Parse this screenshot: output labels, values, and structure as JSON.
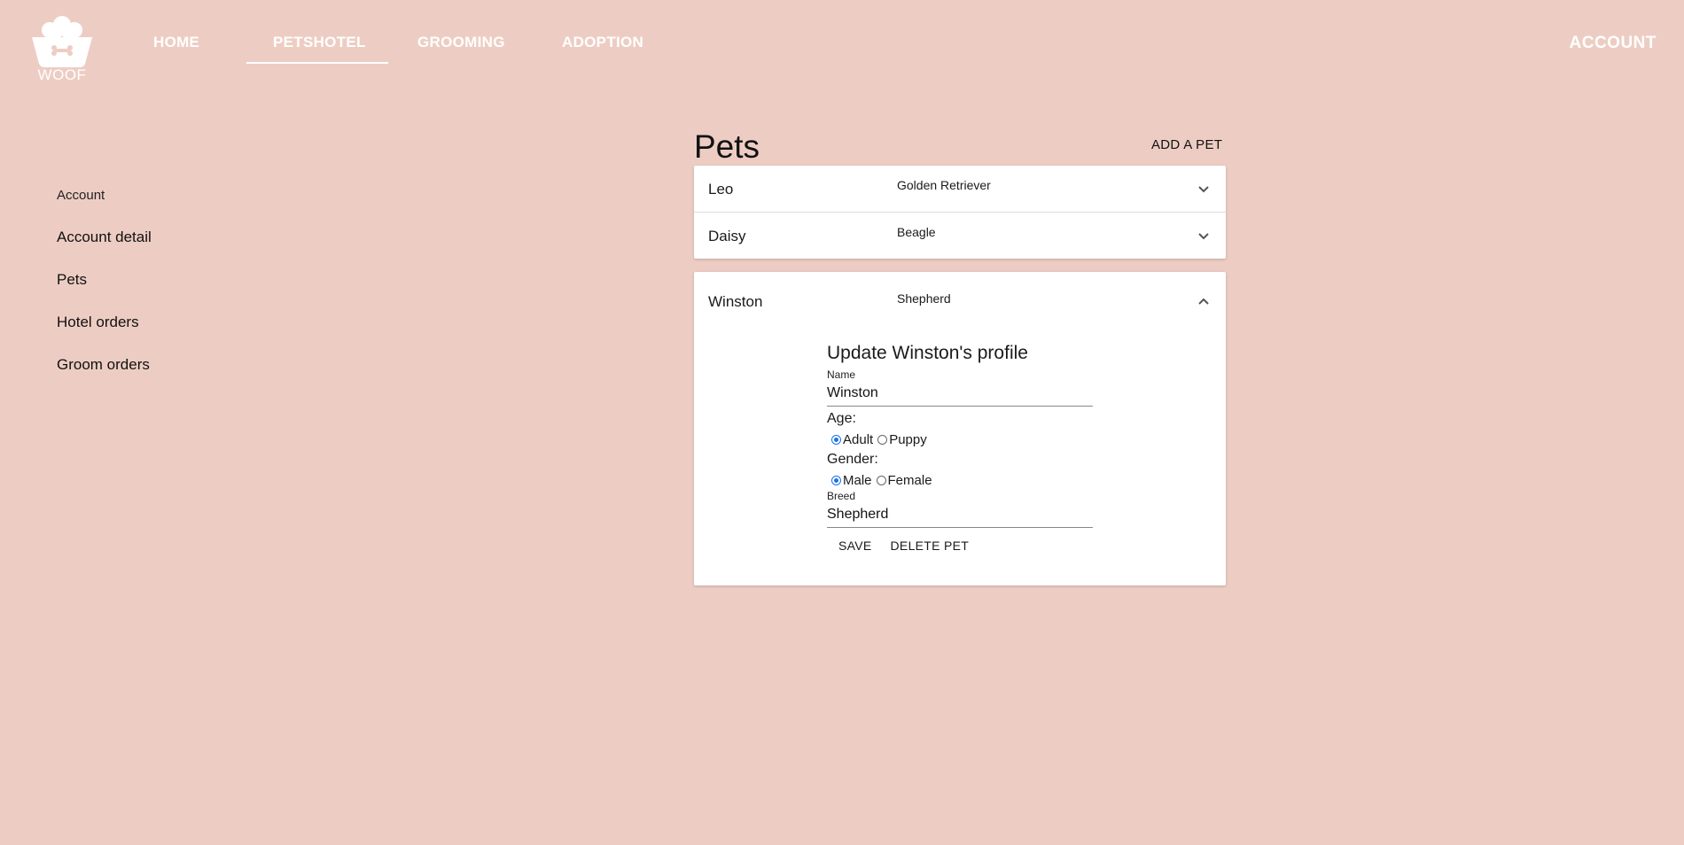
{
  "header": {
    "logo_text": "WOOF",
    "nav": [
      {
        "label": "HOME",
        "active": false
      },
      {
        "label": "PETSHOTEL",
        "active": true
      },
      {
        "label": "GROOMING",
        "active": false
      },
      {
        "label": "ADOPTION",
        "active": false
      }
    ],
    "account_label": "ACCOUNT"
  },
  "sidebar": {
    "heading": "Account",
    "items": [
      {
        "label": "Account detail"
      },
      {
        "label": "Pets"
      },
      {
        "label": "Hotel orders"
      },
      {
        "label": "Groom orders"
      }
    ]
  },
  "main": {
    "title": "Pets",
    "add_button": "ADD A PET",
    "pets": [
      {
        "name": "Leo",
        "breed": "Golden Retriever",
        "expanded": false
      },
      {
        "name": "Daisy",
        "breed": "Beagle",
        "expanded": false
      }
    ],
    "expanded_pet": {
      "name": "Winston",
      "breed": "Shepherd",
      "form": {
        "title": "Update Winston's profile",
        "name_label": "Name",
        "name_value": "Winston",
        "age_label": "Age:",
        "age_options": [
          {
            "label": "Adult",
            "checked": true
          },
          {
            "label": "Puppy",
            "checked": false
          }
        ],
        "gender_label": "Gender:",
        "gender_options": [
          {
            "label": "Male",
            "checked": true
          },
          {
            "label": "Female",
            "checked": false
          }
        ],
        "breed_label": "Breed",
        "breed_value": "Shepherd",
        "save_label": "SAVE",
        "delete_label": "DELETE PET"
      }
    }
  },
  "colors": {
    "background": "#edcdc3",
    "radio_accent": "#1a73e8"
  },
  "icons": [
    "dog-bowl-logo-icon",
    "chevron-down-icon",
    "chevron-up-icon"
  ]
}
